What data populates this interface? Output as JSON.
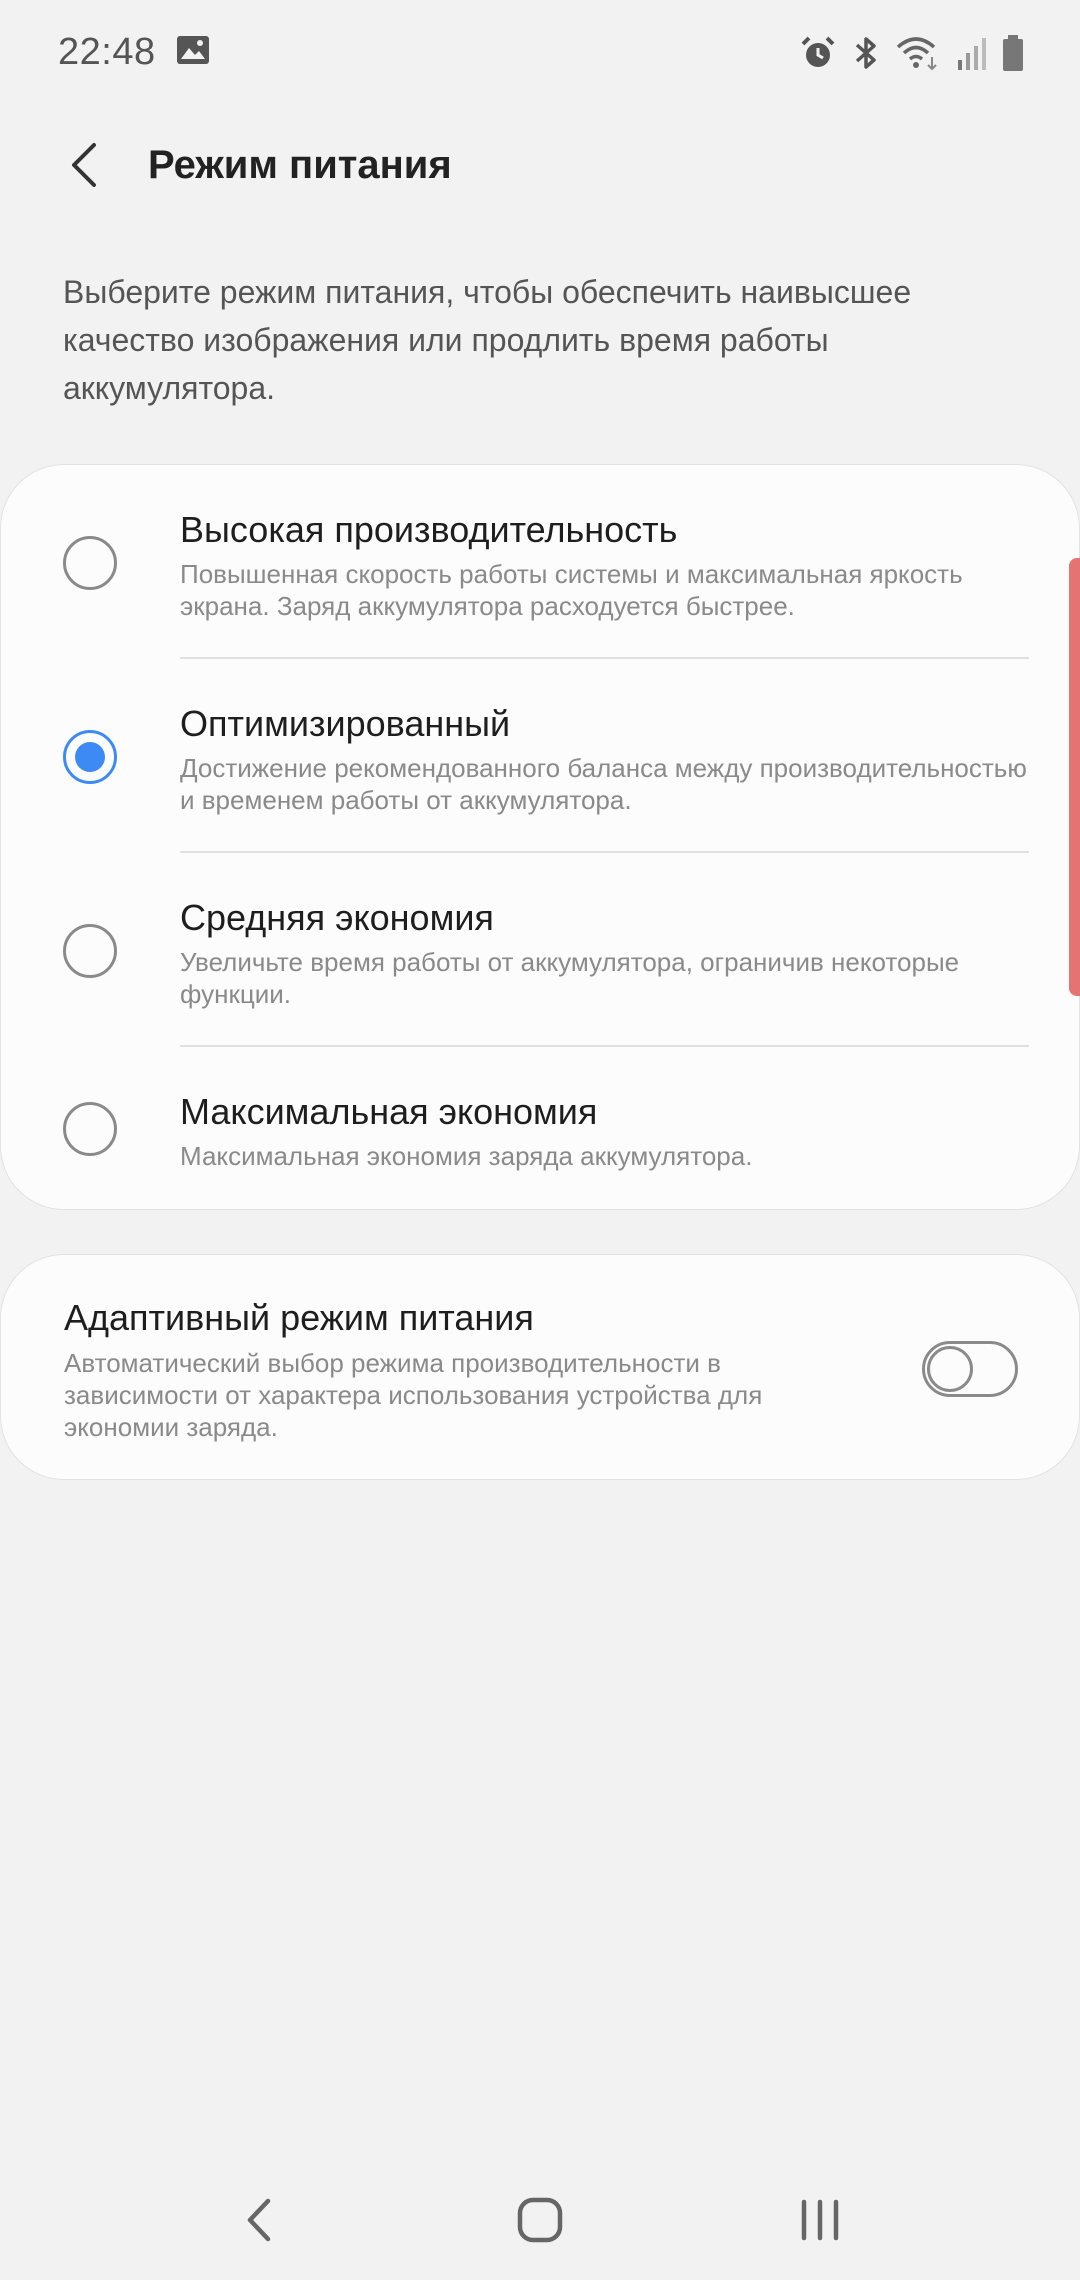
{
  "status_bar": {
    "time": "22:48",
    "icons": [
      "image-icon",
      "alarm-icon",
      "bluetooth-icon",
      "wifi-icon",
      "signal-icon",
      "battery-icon"
    ]
  },
  "header": {
    "title": "Режим питания"
  },
  "description": "Выберите режим питания, чтобы обеспечить наивысшее качество изображения или продлить время работы аккумулятора.",
  "modes": [
    {
      "title": "Высокая производительность",
      "description": "Повышенная скорость работы системы и максимальная яркость экрана. Заряд аккумулятора расходуется быстрее.",
      "selected": false
    },
    {
      "title": "Оптимизированный",
      "description": "Достижение рекомендованного баланса между производительностью и временем работы от аккумулятора.",
      "selected": true
    },
    {
      "title": "Средняя экономия",
      "description": "Увеличьте время работы от аккумулятора, ограничив некоторые функции.",
      "selected": false
    },
    {
      "title": "Максимальная экономия",
      "description": "Максимальная экономия заряда аккумулятора.",
      "selected": false
    }
  ],
  "adaptive": {
    "title": "Адаптивный режим питания",
    "description": "Автоматический выбор режима производительности в зависимости от характера использования устройства для экономии заряда.",
    "enabled": false
  },
  "colors": {
    "accent": "#3e8af5",
    "background": "#f2f2f2",
    "card": "#fcfcfc",
    "scroll_indicator": "#e57373"
  },
  "nav_bar": {
    "icons": [
      "back-icon",
      "home-icon",
      "recents-icon"
    ]
  }
}
